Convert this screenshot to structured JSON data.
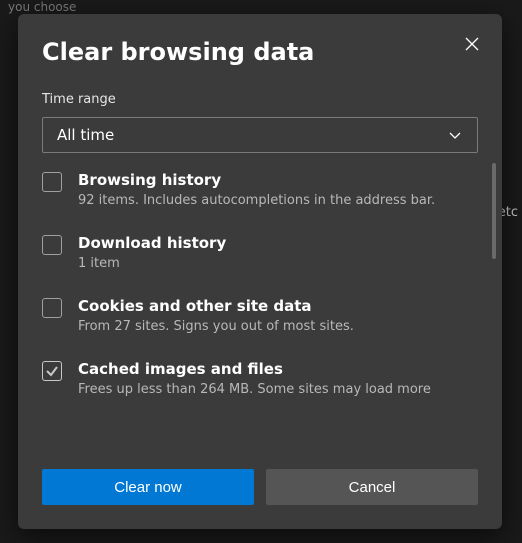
{
  "bg": {
    "hint": "you choose",
    "right": "etc"
  },
  "dialog": {
    "title": "Clear browsing data",
    "time_range_label": "Time range",
    "time_range_value": "All time",
    "items": [
      {
        "title": "Browsing history",
        "subtitle": "92 items. Includes autocompletions in the address bar.",
        "checked": false
      },
      {
        "title": "Download history",
        "subtitle": "1 item",
        "checked": false
      },
      {
        "title": "Cookies and other site data",
        "subtitle": "From 27 sites. Signs you out of most sites.",
        "checked": false
      },
      {
        "title": "Cached images and files",
        "subtitle": "Frees up less than 264 MB. Some sites may load more",
        "checked": true
      }
    ],
    "primary_button": "Clear now",
    "secondary_button": "Cancel"
  }
}
